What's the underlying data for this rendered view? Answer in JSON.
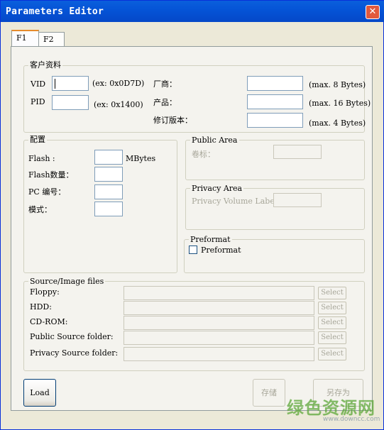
{
  "window": {
    "title": "Parameters Editor",
    "close_glyph": "✕"
  },
  "tabs": [
    {
      "label": "F1",
      "active": true
    },
    {
      "label": "F2",
      "active": false
    }
  ],
  "customer": {
    "legend": "客户资料",
    "vid_label": "VID",
    "vid_value": "",
    "vid_hint": "(ex: 0x0D7D)",
    "pid_label": "PID",
    "pid_value": "",
    "pid_hint": "(ex: 0x1400)",
    "vendor_label": "厂商：",
    "vendor_value": "",
    "vendor_hint": "(max. 8 Bytes)",
    "product_label": "产品：",
    "product_value": "",
    "product_hint": "(max. 16 Bytes)",
    "revision_label": "修订版本：",
    "revision_value": "",
    "revision_hint": "(max. 4 Bytes)"
  },
  "config": {
    "legend": "配置",
    "flash_label": "Flash :",
    "flash_value": "",
    "flash_unit": "MBytes",
    "flash_count_label": "Flash数量：",
    "flash_count_value": "",
    "pc_number_label": "PC 编号：",
    "pc_number_value": "",
    "mode_label": "模式：",
    "mode_value": ""
  },
  "public_area": {
    "legend": "Public Area",
    "label_label": "卷标：",
    "label_value": ""
  },
  "privacy_area": {
    "legend": "Privacy Area",
    "volume_label_label": "Privacy Volume Label:",
    "volume_label_value": ""
  },
  "preformat": {
    "legend": "Preformat",
    "checkbox_label": "Preformat",
    "checked": false
  },
  "source_files": {
    "legend": "Source/Image files",
    "rows": [
      {
        "label": "Floppy:",
        "value": "",
        "button": "Select"
      },
      {
        "label": "HDD:",
        "value": "",
        "button": "Select"
      },
      {
        "label": "CD-ROM:",
        "value": "",
        "button": "Select"
      },
      {
        "label": "Public Source folder:",
        "value": "",
        "button": "Select"
      },
      {
        "label": "Privacy Source folder:",
        "value": "",
        "button": "Select"
      }
    ]
  },
  "buttons": {
    "load": "Load",
    "save": "存储",
    "save_as": "另存为"
  },
  "watermark": {
    "text": "绿色资源网",
    "url": "www.downcc.com"
  },
  "colors": {
    "titlebar": "#0553d6",
    "close": "#e2593d",
    "face": "#ece9d8",
    "watermark": "#5ea83a"
  }
}
